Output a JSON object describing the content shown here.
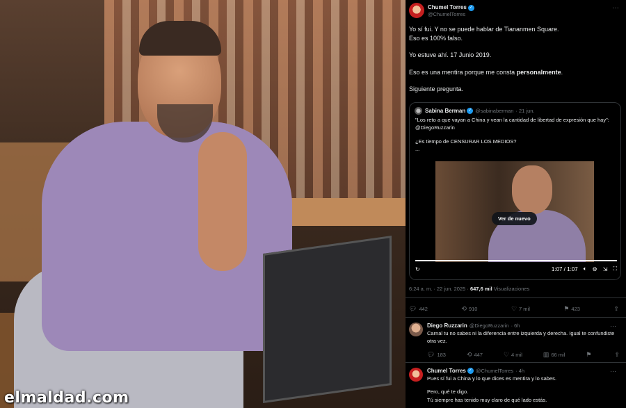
{
  "watermark": "elmaldad.com",
  "main_tweet": {
    "name": "Chumel Torres",
    "handle": "@ChumelTorres",
    "paragraphs": [
      "Yo sí fui. Y no se puede hablar de Tiananmen Square.",
      "Eso es 100% falso.",
      "Yo estuve ahí. 17 Junio 2019.",
      "Eso es una mentira porque me consta ",
      "personalmente",
      ".",
      "Siguiente pregunta."
    ],
    "quote": {
      "name": "Sabina Berman",
      "handle": "@sabinaberman",
      "date": "· 21 jun.",
      "text1": "\"Los reto a que vayan a China y vean la cantidad de libertad de expresión que hay\": @DiegoRuzzarin",
      "text2": "¿Es tiempo de CENSURAR LOS MEDIOS?",
      "text3": "...",
      "video_button": "Ver de nuevo",
      "video_time": "1:07 / 1:07"
    },
    "timestamp": "6:24 a. m. · 22 jun. 2025 · ",
    "views_count": "647,6 mil",
    "views_label": " Visualizaciones",
    "actions": {
      "replies": "442",
      "retweets": "910",
      "likes": "7 mil",
      "bookmarks": "423"
    }
  },
  "replies": [
    {
      "name": "Diego Ruzzarin",
      "handle": "@DiegoRuzzarin",
      "time": "· 6h",
      "text": "Carnal tu no sabes ni la diferencia entre izquierda y derecha. Igual te confundiste otra vez.",
      "actions": {
        "replies": "183",
        "retweets": "447",
        "likes": "4 mil",
        "views": "66 mil"
      }
    },
    {
      "name": "Chumel Torres",
      "handle": "@ChumelTorres",
      "time": "· 4h",
      "text": "Pues sí fui a China y lo que dices es mentira y lo sabes.",
      "text2": "Pero, qué te digo.",
      "text3": "Tú siempre has tenido muy claro de qué lado estás."
    }
  ],
  "colors": {
    "background": "#000000",
    "text": "#e7e9ea",
    "muted": "#71767b",
    "verified": "#1d9bf0",
    "border": "#2f3336"
  },
  "icons": [
    "more-icon",
    "verified-icon",
    "reply-icon",
    "retweet-icon",
    "like-icon",
    "views-icon",
    "bookmark-icon",
    "share-icon",
    "replay-icon",
    "volume-icon",
    "settings-icon",
    "fullscreen-icon"
  ]
}
